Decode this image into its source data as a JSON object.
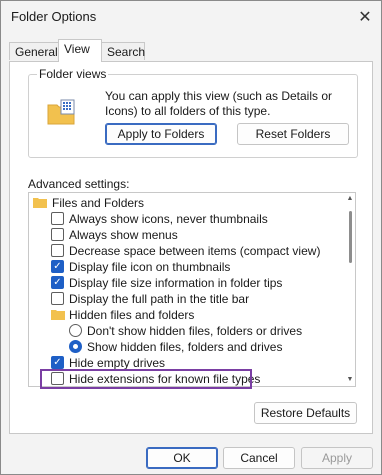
{
  "window": {
    "title": "Folder Options",
    "close_glyph": "✕"
  },
  "tabs": [
    {
      "label": "General",
      "active": false
    },
    {
      "label": "View",
      "active": true
    },
    {
      "label": "Search",
      "active": false
    }
  ],
  "folder_views": {
    "label": "Folder views",
    "description": "You can apply this view (such as Details or Icons) to all folders of this type.",
    "apply_button": "Apply to Folders",
    "reset_button": "Reset Folders"
  },
  "advanced": {
    "label": "Advanced settings:",
    "items": [
      {
        "type": "folder",
        "text": "Files and Folders",
        "indent": 0
      },
      {
        "type": "checkbox",
        "text": "Always show icons, never thumbnails",
        "checked": false,
        "indent": 1
      },
      {
        "type": "checkbox",
        "text": "Always show menus",
        "checked": false,
        "indent": 1
      },
      {
        "type": "checkbox",
        "text": "Decrease space between items (compact view)",
        "checked": false,
        "indent": 1
      },
      {
        "type": "checkbox",
        "text": "Display file icon on thumbnails",
        "checked": true,
        "indent": 1
      },
      {
        "type": "checkbox",
        "text": "Display file size information in folder tips",
        "checked": true,
        "indent": 1
      },
      {
        "type": "checkbox",
        "text": "Display the full path in the title bar",
        "checked": false,
        "indent": 1
      },
      {
        "type": "folder",
        "text": "Hidden files and folders",
        "indent": 1
      },
      {
        "type": "radio",
        "text": "Don't show hidden files, folders or drives",
        "checked": false,
        "indent": 2
      },
      {
        "type": "radio",
        "text": "Show hidden files, folders and drives",
        "checked": true,
        "indent": 2
      },
      {
        "type": "checkbox",
        "text": "Hide empty drives",
        "checked": true,
        "indent": 1
      },
      {
        "type": "checkbox",
        "text": "Hide extensions for known file types",
        "checked": false,
        "indent": 1
      }
    ]
  },
  "restore_defaults": "Restore Defaults",
  "buttons": {
    "ok": "OK",
    "cancel": "Cancel",
    "apply": "Apply"
  },
  "colors": {
    "accent": "#1e5fc6",
    "highlight": "#7a3ea3",
    "folder": "#f2c14e"
  }
}
